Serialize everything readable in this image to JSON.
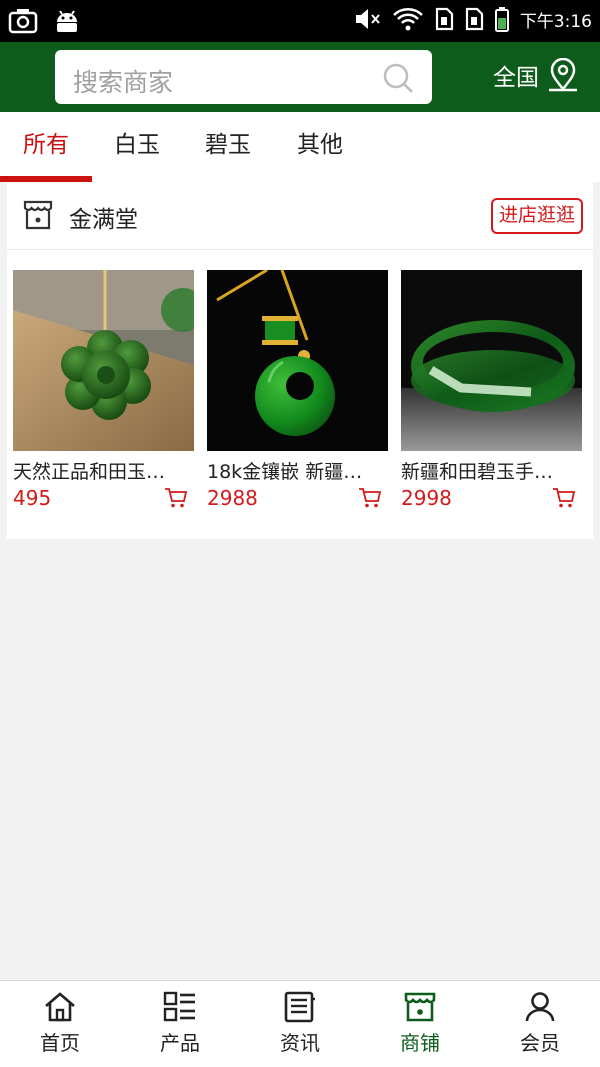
{
  "status_bar": {
    "time": "下午3:16",
    "left_icons": [
      "screenshot-icon",
      "android-icon"
    ],
    "right_icons": [
      "mute-icon",
      "wifi-icon",
      "sim1-icon",
      "sim2-icon",
      "battery-icon"
    ]
  },
  "header": {
    "search_placeholder": "搜索商家",
    "region_label": "全国"
  },
  "tabs": [
    {
      "label": "所有",
      "active": true
    },
    {
      "label": "白玉",
      "active": false
    },
    {
      "label": "碧玉",
      "active": false
    },
    {
      "label": "其他",
      "active": false
    }
  ],
  "shop": {
    "name": "金满堂",
    "visit_label": "进店逛逛",
    "products": [
      {
        "name": "天然正品和田玉…",
        "price": "495"
      },
      {
        "name": "18k金镶嵌 新疆…",
        "price": "2988"
      },
      {
        "name": "新疆和田碧玉手…",
        "price": "2998"
      }
    ]
  },
  "bottom_nav": [
    {
      "label": "首页",
      "icon": "home-icon",
      "active": false
    },
    {
      "label": "产品",
      "icon": "list-icon",
      "active": false
    },
    {
      "label": "资讯",
      "icon": "news-icon",
      "active": false
    },
    {
      "label": "商铺",
      "icon": "store-icon",
      "active": true
    },
    {
      "label": "会员",
      "icon": "user-icon",
      "active": false
    }
  ],
  "colors": {
    "brand_green": "#0d5c1b",
    "accent_red": "#d41b1b",
    "background": "#f2f2f2"
  }
}
